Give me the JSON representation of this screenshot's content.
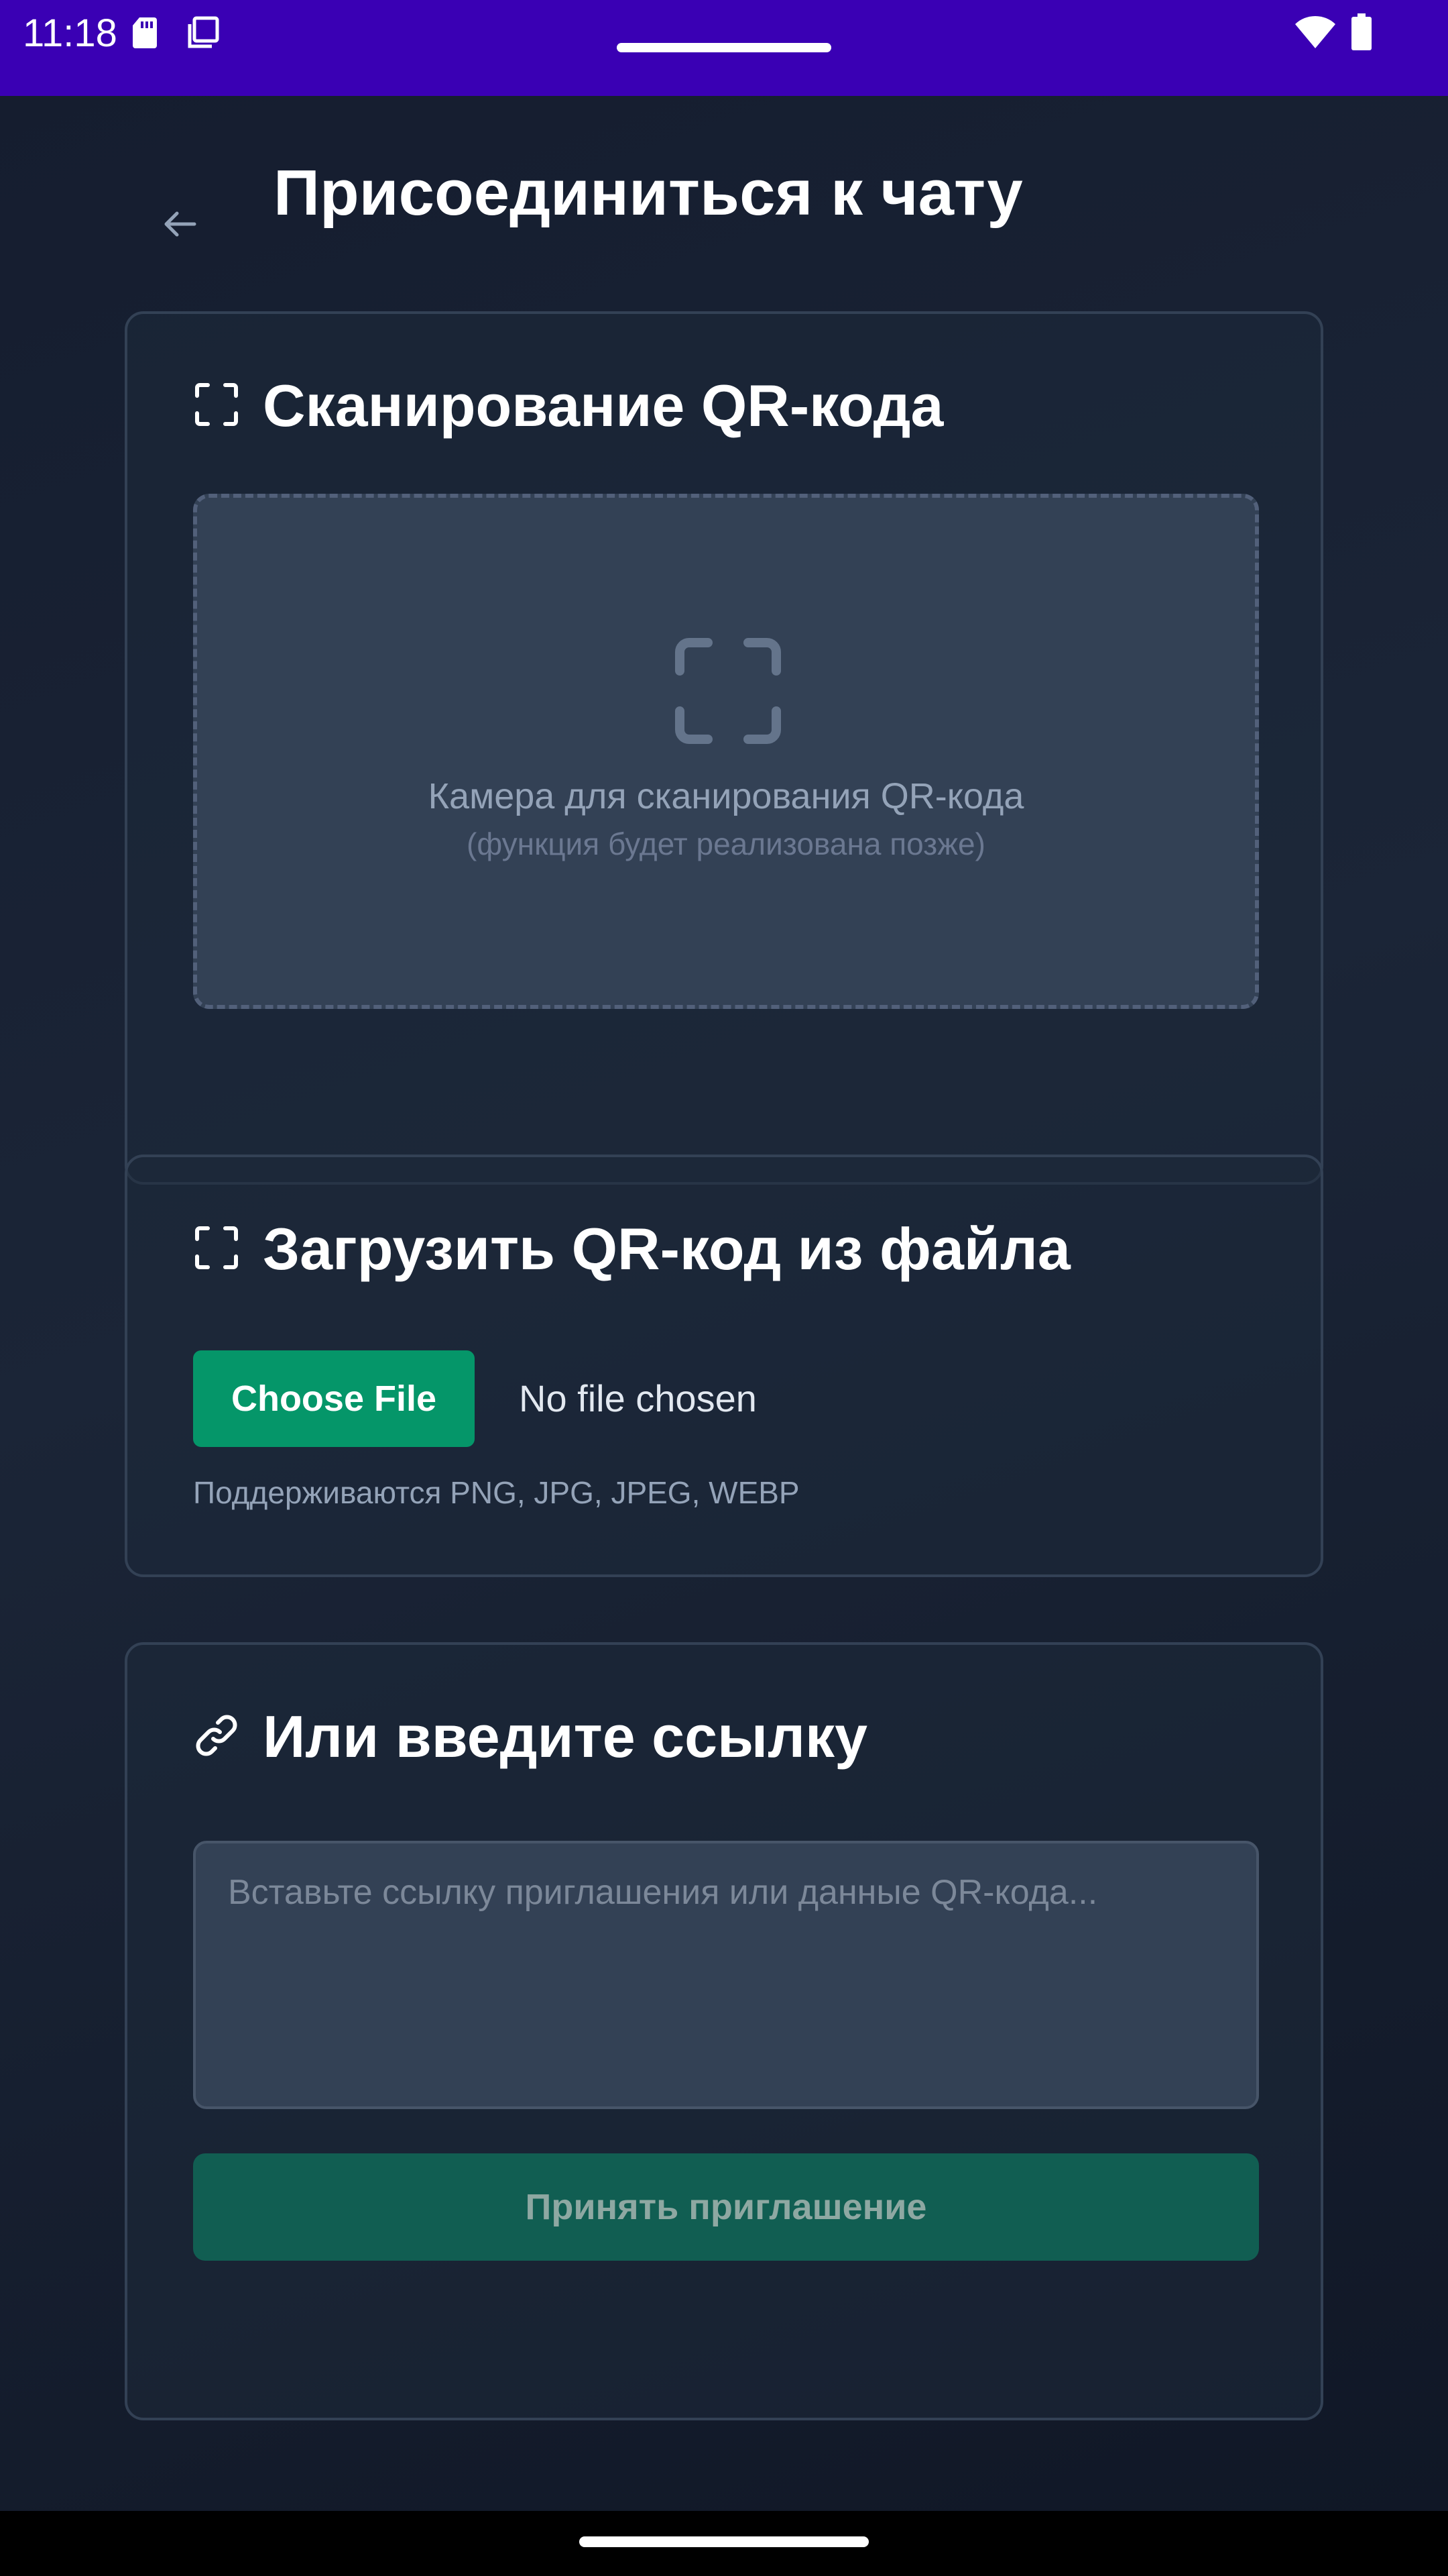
{
  "status_bar": {
    "time": "11:18",
    "icons": [
      "sd-card-icon",
      "screenshot-icon",
      "wifi-icon",
      "battery-icon"
    ]
  },
  "header": {
    "back_icon": "arrow-left-icon",
    "title": "Присоединиться к чату"
  },
  "scan_card": {
    "icon": "scan-frame-icon",
    "title": "Сканирование QR-кода",
    "camera_icon": "scan-frame-icon",
    "camera_text": "Камера для сканирования QR-кода",
    "camera_note": "(функция будет реализована позже)"
  },
  "upload_card": {
    "icon": "scan-frame-icon",
    "title": "Загрузить QR-код из файла",
    "button_label": "Choose File",
    "file_status": "No file chosen",
    "formats_hint": "Поддерживаются PNG, JPG, JPEG, WEBP"
  },
  "link_card": {
    "icon": "link-icon",
    "title": "Или введите ссылку",
    "input_value": "",
    "input_placeholder": "Вставьте ссылку приглашения или данные QR-кода...",
    "accept_label": "Принять приглашение"
  },
  "colors": {
    "status_bar": "#3a00b4",
    "background": "#151d2e",
    "card_border": "#334155",
    "accent_green": "#059669",
    "accept_disabled": "#115e52"
  }
}
